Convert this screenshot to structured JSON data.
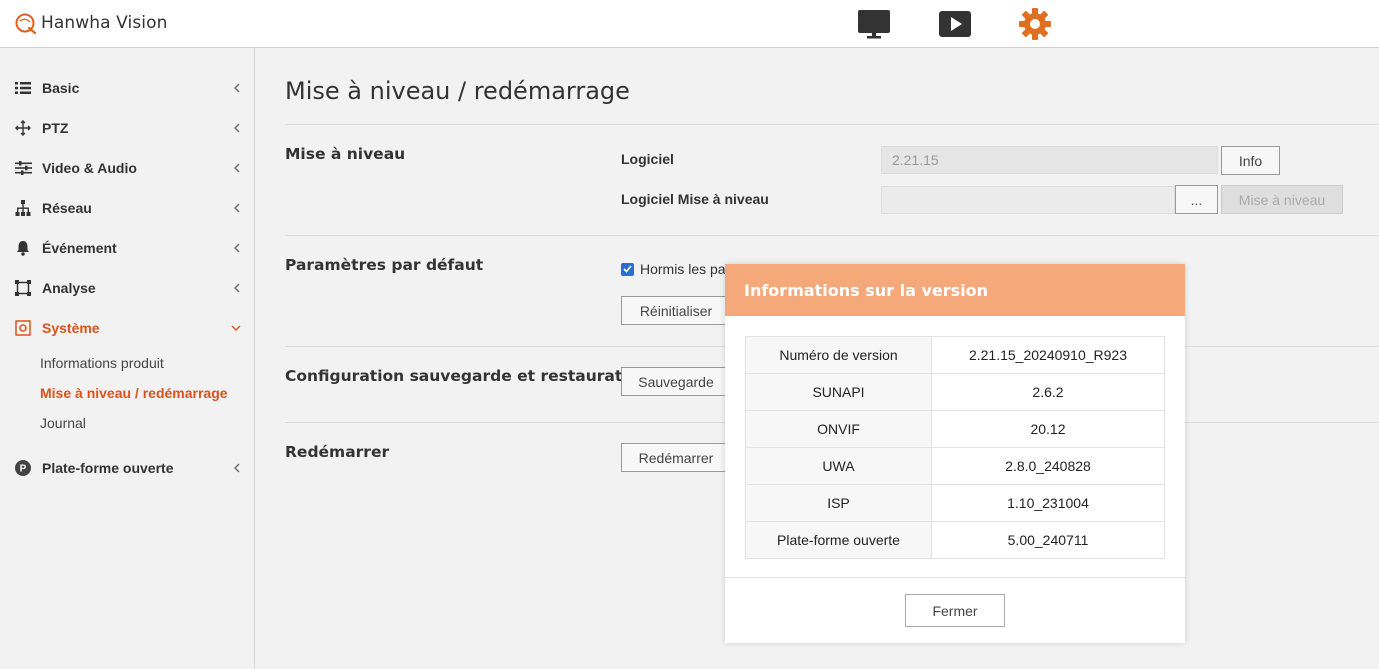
{
  "brand": {
    "name": "Hanwha Vision"
  },
  "header_icons": [
    {
      "name": "monitor-icon"
    },
    {
      "name": "play-icon"
    },
    {
      "name": "gear-icon",
      "color": "#e07020"
    }
  ],
  "sidebar": {
    "items": [
      {
        "label": "Basic",
        "icon": "list-icon"
      },
      {
        "label": "PTZ",
        "icon": "move-icon"
      },
      {
        "label": "Video & Audio",
        "icon": "sliders-icon"
      },
      {
        "label": "Réseau",
        "icon": "network-icon"
      },
      {
        "label": "Événement",
        "icon": "bell-icon"
      },
      {
        "label": "Analyse",
        "icon": "frame-icon"
      },
      {
        "label": "Système",
        "icon": "system-icon",
        "active": true
      },
      {
        "label": "Plate-forme ouverte",
        "icon": "platform-icon"
      }
    ],
    "subitems": [
      {
        "label": "Informations produit"
      },
      {
        "label": "Mise à niveau / redémarrage",
        "active": true
      },
      {
        "label": "Journal"
      }
    ],
    "active_color": "#d8541d"
  },
  "main": {
    "title": "Mise à niveau / redémarrage",
    "upgrade": {
      "section": "Mise à niveau",
      "software_label": "Logiciel",
      "software_value": "2.21.15",
      "info_button": "Info",
      "upgrade_label": "Logiciel Mise à niveau",
      "browse_button": "...",
      "upgrade_button": "Mise à niveau"
    },
    "defaults": {
      "section": "Paramètres par défaut",
      "checkbox_label": "Hormis les pa",
      "reset_button": "Réinitialiser"
    },
    "backup": {
      "section": "Configuration sauvegarde et restauration",
      "save_button": "Sauvegarde"
    },
    "restart": {
      "section": "Redémarrer",
      "restart_button": "Redémarrer"
    }
  },
  "modal": {
    "title": "Informations sur la version",
    "header_color": "#f5a97a",
    "rows": [
      {
        "key": "Numéro de version",
        "value": "2.21.15_20240910_R923"
      },
      {
        "key": "SUNAPI",
        "value": "2.6.2"
      },
      {
        "key": "ONVIF",
        "value": "20.12"
      },
      {
        "key": "UWA",
        "value": "2.8.0_240828"
      },
      {
        "key": "ISP",
        "value": "1.10_231004"
      },
      {
        "key": "Plate-forme ouverte",
        "value": "5.00_240711"
      }
    ],
    "close_button": "Fermer"
  }
}
